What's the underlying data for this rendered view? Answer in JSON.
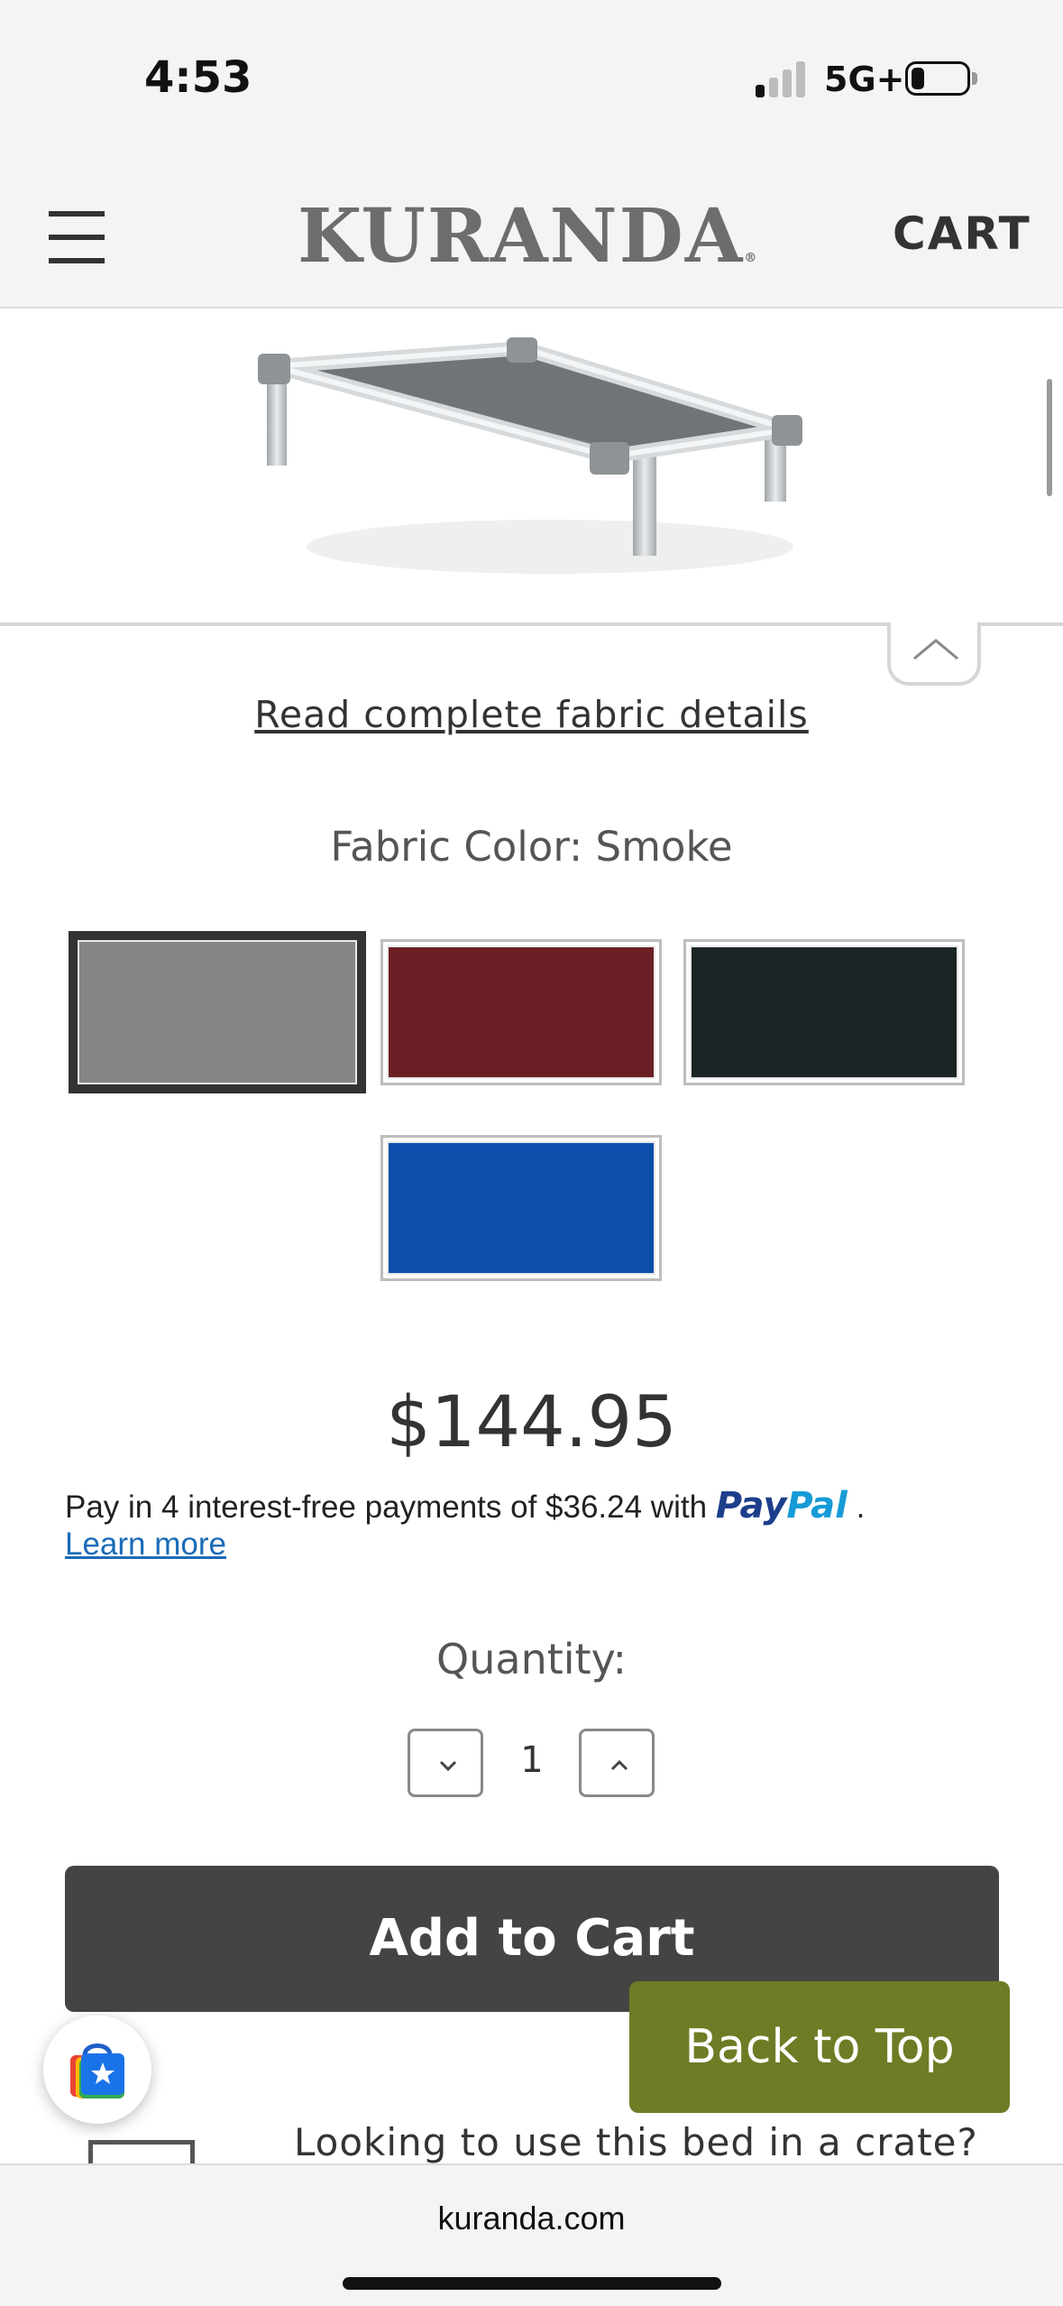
{
  "status_bar": {
    "time": "4:53",
    "network": "5G+"
  },
  "header": {
    "logo": "KURANDA",
    "logo_mark": "®",
    "cart_label": "CART"
  },
  "product": {
    "fabric_details_link": "Read complete fabric details",
    "fabric_color_label": "Fabric Color: Smoke",
    "swatches": [
      {
        "name": "Smoke",
        "color": "#858585",
        "selected": true
      },
      {
        "name": "Burgundy",
        "color": "#6b1f24",
        "selected": false
      },
      {
        "name": "Black",
        "color": "#1b2526",
        "selected": false
      },
      {
        "name": "Royal Blue",
        "color": "#0d4eac",
        "selected": false
      }
    ],
    "price": "$144.95",
    "paypal": {
      "text": "Pay in 4 interest-free payments of $36.24 with",
      "brand_pay": "Pay",
      "brand_pal": "Pal",
      "suffix": ".",
      "learn_more": "Learn more"
    },
    "quantity_label": "Quantity:",
    "quantity_value": "1",
    "add_to_cart_label": "Add to Cart",
    "crate_prompt": "Looking to use this bed in a crate?"
  },
  "back_to_top_label": "Back to Top",
  "browser": {
    "url": "kuranda.com"
  },
  "colors": {
    "accent_green": "#6c7d25",
    "button_dark": "#444444",
    "link_blue": "#1a6bb8"
  }
}
